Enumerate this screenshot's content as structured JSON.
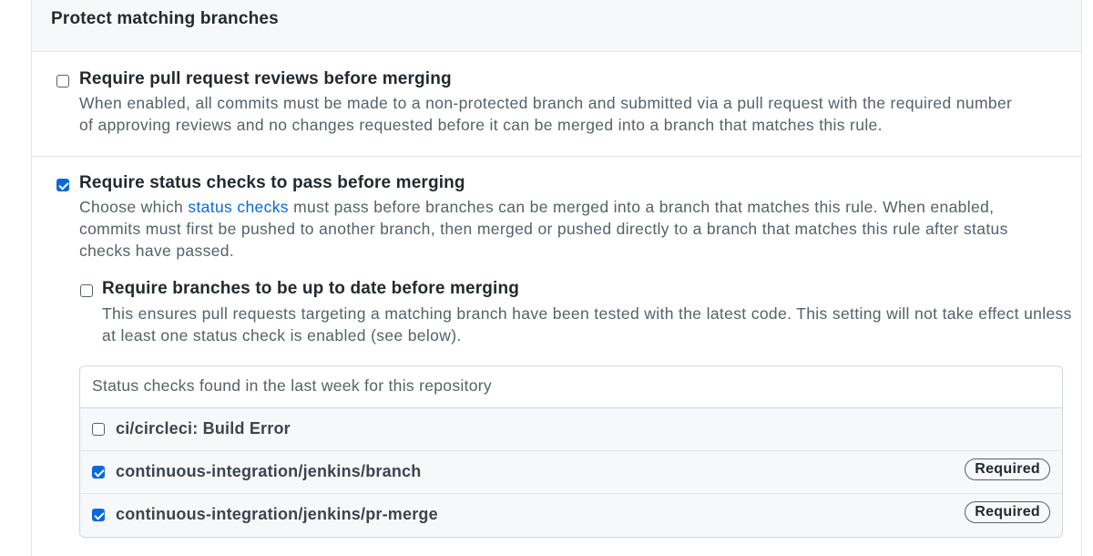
{
  "header": {
    "title": "Protect matching branches"
  },
  "options": [
    {
      "title": "Require pull request reviews before merging",
      "checked": false,
      "description": "When enabled, all commits must be made to a non-protected branch and submitted via a pull request with the required number of approving reviews and no changes requested before it can be merged into a branch that matches this rule."
    },
    {
      "title": "Require status checks to pass before merging",
      "checked": true,
      "description_before_link": "Choose which ",
      "link_text": "status checks",
      "description_after_link": " must pass before branches can be merged into a branch that matches this rule. When enabled, commits must first be pushed to another branch, then merged or pushed directly to a branch that matches this rule after status checks have passed."
    }
  ],
  "sub_option": {
    "title": "Require branches to be up to date before merging",
    "checked": false,
    "description": "This ensures pull requests targeting a matching branch have been tested with the latest code. This setting will not take effect unless at least one status check is enabled (see below)."
  },
  "status_checks": {
    "header": "Status checks found in the last week for this repository",
    "items": [
      {
        "name": "ci/circleci: Build Error",
        "checked": false,
        "badge": ""
      },
      {
        "name": "continuous-integration/jenkins/branch",
        "checked": true,
        "badge": "Required"
      },
      {
        "name": "continuous-integration/jenkins/pr-merge",
        "checked": true,
        "badge": "Required"
      }
    ]
  },
  "colors": {
    "accent": "#0969da",
    "header_bg": "#f6f8fa",
    "border": "#e1e4e8"
  }
}
